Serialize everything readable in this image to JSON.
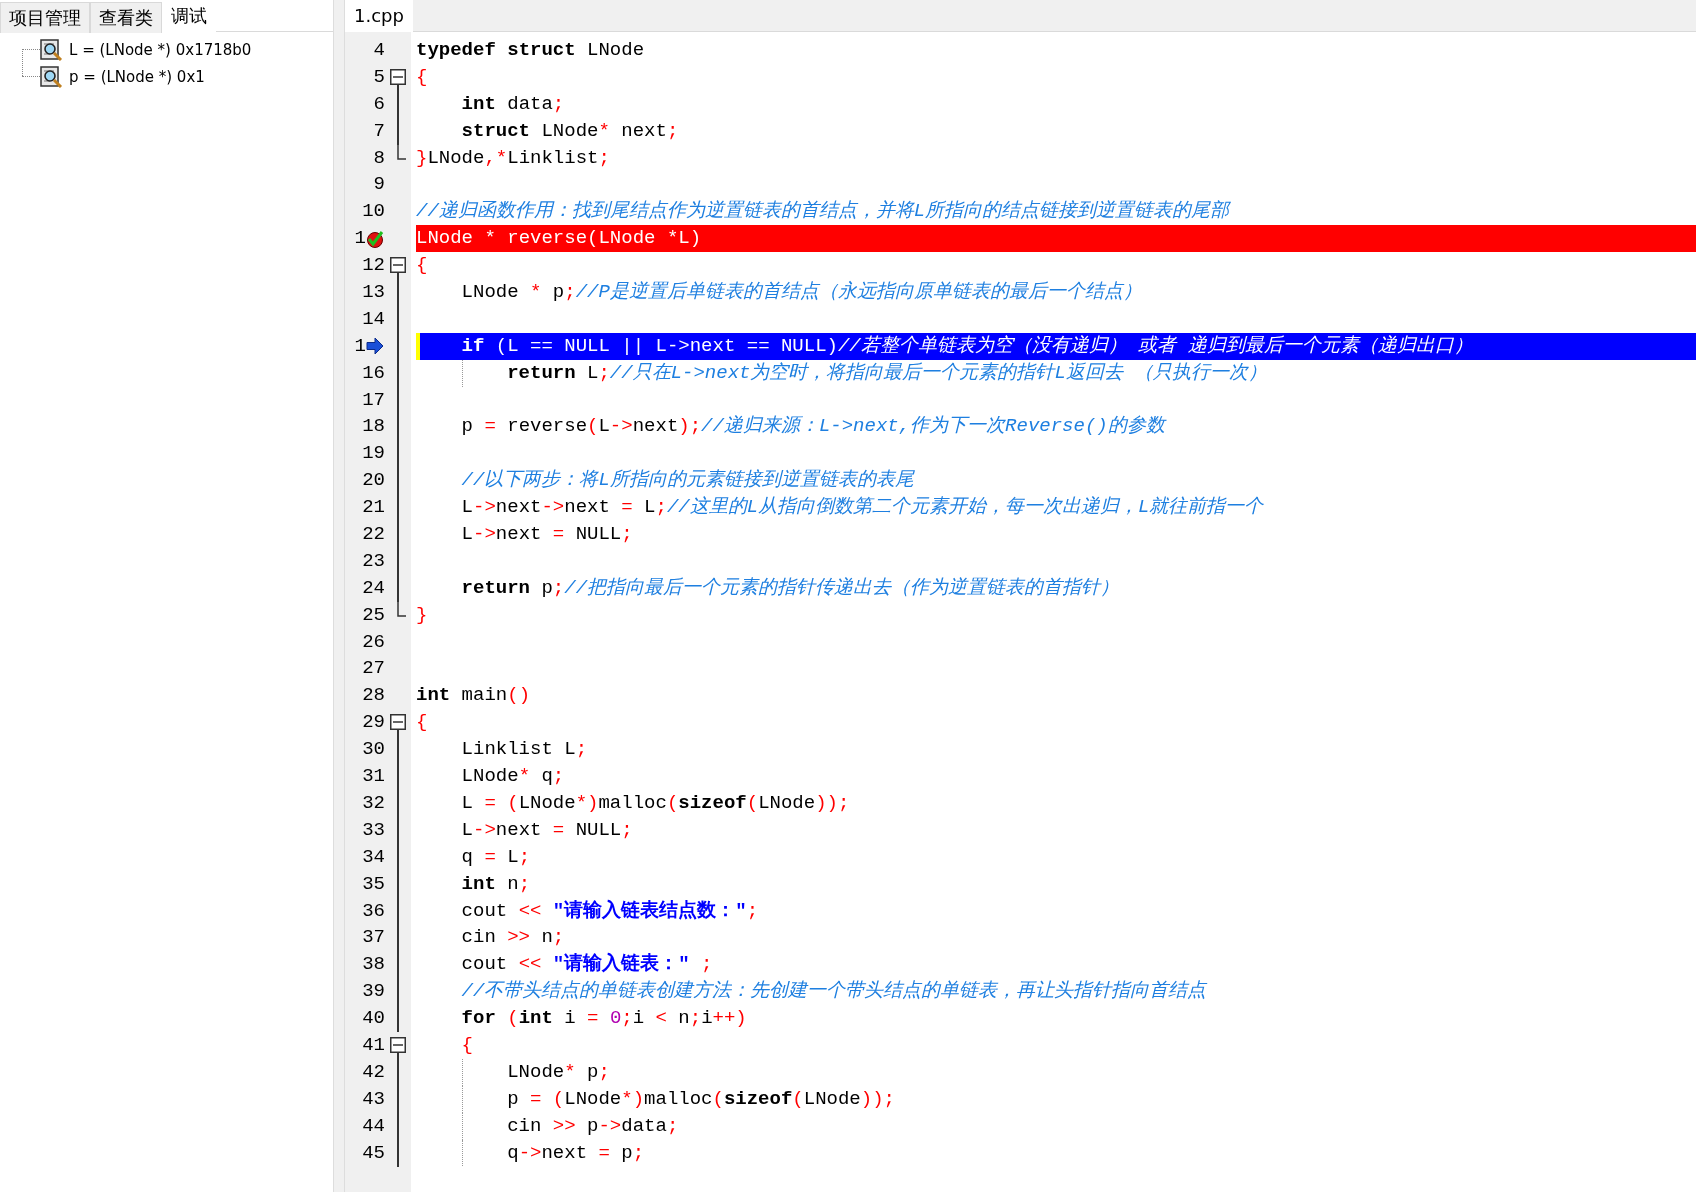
{
  "left_panel": {
    "tabs": [
      {
        "label": "项目管理",
        "selected": false
      },
      {
        "label": "查看类",
        "selected": false
      },
      {
        "label": "调试",
        "selected": true
      }
    ],
    "watches": [
      {
        "text": "L = (LNode *) 0x1718b0"
      },
      {
        "text": "p = (LNode *) 0x1"
      }
    ]
  },
  "editor": {
    "tabs": [
      {
        "label": "1.cpp",
        "selected": true
      }
    ],
    "lines": [
      {
        "number": "4",
        "kind": "normal",
        "tokens": [
          {
            "kind": "kw",
            "text": "typedef"
          },
          {
            "kind": "kw",
            "text": " struct"
          },
          {
            "kind": "id",
            "text": " LNode"
          }
        ]
      },
      {
        "number": "5",
        "kind": "normal",
        "fold_start": true,
        "tokens": [
          {
            "kind": "op",
            "text": "{"
          }
        ]
      },
      {
        "number": "6",
        "kind": "normal",
        "fold_body": true,
        "tokens": [
          {
            "kind": "kw",
            "text": "    int"
          },
          {
            "kind": "id",
            "text": " data"
          },
          {
            "kind": "op",
            "text": ";"
          }
        ]
      },
      {
        "number": "7",
        "kind": "normal",
        "fold_body": true,
        "tokens": [
          {
            "kind": "kw",
            "text": "    struct"
          },
          {
            "kind": "id",
            "text": " LNode"
          },
          {
            "kind": "op",
            "text": "*"
          },
          {
            "kind": "id",
            "text": " next"
          },
          {
            "kind": "op",
            "text": ";"
          }
        ]
      },
      {
        "number": "8",
        "kind": "normal",
        "fold_end": true,
        "tokens": [
          {
            "kind": "op",
            "text": "}"
          },
          {
            "kind": "id",
            "text": "LNode"
          },
          {
            "kind": "op",
            "text": ",*"
          },
          {
            "kind": "id",
            "text": "Linklist"
          },
          {
            "kind": "op",
            "text": ";"
          }
        ]
      },
      {
        "number": "9",
        "kind": "normal"
      },
      {
        "number": "10",
        "kind": "normal",
        "tokens": [
          {
            "kind": "cmt",
            "text": "//递归函数作用：找到尾结点作为逆置链表的首结点，并将L所指向的结点链接到逆置链表的尾部"
          }
        ]
      },
      {
        "number": "1",
        "kind": "breakpoint",
        "tokens": [
          {
            "kind": "id",
            "text": "LNode "
          },
          {
            "kind": "op",
            "text": "*"
          },
          {
            "kind": "id",
            "text": " reverse"
          },
          {
            "kind": "op",
            "text": "("
          },
          {
            "kind": "id",
            "text": "LNode "
          },
          {
            "kind": "op",
            "text": "*"
          },
          {
            "kind": "id",
            "text": "L"
          },
          {
            "kind": "op",
            "text": ")"
          }
        ]
      },
      {
        "number": "12",
        "kind": "normal",
        "fold_start": true,
        "tokens": [
          {
            "kind": "op",
            "text": "{"
          }
        ]
      },
      {
        "number": "13",
        "kind": "normal",
        "fold_body": true,
        "tokens": [
          {
            "kind": "id",
            "text": "    LNode "
          },
          {
            "kind": "op",
            "text": "*"
          },
          {
            "kind": "id",
            "text": " p"
          },
          {
            "kind": "op",
            "text": ";"
          },
          {
            "kind": "cmt",
            "text": "//P是逆置后单链表的首结点（永远指向原单链表的最后一个结点）"
          }
        ]
      },
      {
        "number": "14",
        "kind": "normal",
        "fold_body": true
      },
      {
        "number": "1",
        "kind": "current",
        "fold_body": true,
        "tokens": [
          {
            "kind": "kw",
            "text": "    if"
          },
          {
            "kind": "op",
            "text": " ("
          },
          {
            "kind": "id",
            "text": "L "
          },
          {
            "kind": "op",
            "text": "=="
          },
          {
            "kind": "id",
            "text": " NULL "
          },
          {
            "kind": "op",
            "text": "||"
          },
          {
            "kind": "id",
            "text": " L"
          },
          {
            "kind": "op",
            "text": "->"
          },
          {
            "kind": "id",
            "text": "next "
          },
          {
            "kind": "op",
            "text": "=="
          },
          {
            "kind": "id",
            "text": " NULL"
          },
          {
            "kind": "op",
            "text": ")"
          },
          {
            "kind": "cmt",
            "text": "//若整个单链表为空（没有递归） 或者 递归到最后一个元素（递归出口）"
          }
        ]
      },
      {
        "number": "16",
        "kind": "normal",
        "fold_body": true,
        "guide": true,
        "tokens": [
          {
            "kind": "kw",
            "text": "        return"
          },
          {
            "kind": "id",
            "text": " L"
          },
          {
            "kind": "op",
            "text": ";"
          },
          {
            "kind": "cmt",
            "text": "//只在L->next为空时，将指向最后一个元素的指针L返回去 （只执行一次）"
          }
        ]
      },
      {
        "number": "17",
        "kind": "normal",
        "fold_body": true
      },
      {
        "number": "18",
        "kind": "normal",
        "fold_body": true,
        "tokens": [
          {
            "kind": "id",
            "text": "    p "
          },
          {
            "kind": "op",
            "text": "="
          },
          {
            "kind": "id",
            "text": " reverse"
          },
          {
            "kind": "op",
            "text": "("
          },
          {
            "kind": "id",
            "text": "L"
          },
          {
            "kind": "op",
            "text": "->"
          },
          {
            "kind": "id",
            "text": "next"
          },
          {
            "kind": "op",
            "text": ");"
          },
          {
            "kind": "cmt",
            "text": "//递归来源：L->next,作为下一次Reverse()的参数"
          }
        ]
      },
      {
        "number": "19",
        "kind": "normal",
        "fold_body": true
      },
      {
        "number": "20",
        "kind": "normal",
        "fold_body": true,
        "tokens": [
          {
            "kind": "cmt",
            "text": "    //以下两步：将L所指向的元素链接到逆置链表的表尾"
          }
        ]
      },
      {
        "number": "21",
        "kind": "normal",
        "fold_body": true,
        "tokens": [
          {
            "kind": "id",
            "text": "    L"
          },
          {
            "kind": "op",
            "text": "->"
          },
          {
            "kind": "id",
            "text": "next"
          },
          {
            "kind": "op",
            "text": "->"
          },
          {
            "kind": "id",
            "text": "next "
          },
          {
            "kind": "op",
            "text": "="
          },
          {
            "kind": "id",
            "text": " L"
          },
          {
            "kind": "op",
            "text": ";"
          },
          {
            "kind": "cmt",
            "text": "//这里的L从指向倒数第二个元素开始，每一次出递归，L就往前指一个"
          }
        ]
      },
      {
        "number": "22",
        "kind": "normal",
        "fold_body": true,
        "tokens": [
          {
            "kind": "id",
            "text": "    L"
          },
          {
            "kind": "op",
            "text": "->"
          },
          {
            "kind": "id",
            "text": "next "
          },
          {
            "kind": "op",
            "text": "="
          },
          {
            "kind": "id",
            "text": " NULL"
          },
          {
            "kind": "op",
            "text": ";"
          }
        ]
      },
      {
        "number": "23",
        "kind": "normal",
        "fold_body": true
      },
      {
        "number": "24",
        "kind": "normal",
        "fold_body": true,
        "tokens": [
          {
            "kind": "kw",
            "text": "    return"
          },
          {
            "kind": "id",
            "text": " p"
          },
          {
            "kind": "op",
            "text": ";"
          },
          {
            "kind": "cmt",
            "text": "//把指向最后一个元素的指针传递出去（作为逆置链表的首指针）"
          }
        ]
      },
      {
        "number": "25",
        "kind": "normal",
        "fold_end": true,
        "tokens": [
          {
            "kind": "op",
            "text": "}"
          }
        ]
      },
      {
        "number": "26",
        "kind": "normal"
      },
      {
        "number": "27",
        "kind": "normal"
      },
      {
        "number": "28",
        "kind": "normal",
        "tokens": [
          {
            "kind": "kw",
            "text": "int"
          },
          {
            "kind": "id",
            "text": " main"
          },
          {
            "kind": "op",
            "text": "()"
          }
        ]
      },
      {
        "number": "29",
        "kind": "normal",
        "fold_start": true,
        "tokens": [
          {
            "kind": "op",
            "text": "{"
          }
        ]
      },
      {
        "number": "30",
        "kind": "normal",
        "fold_body": true,
        "tokens": [
          {
            "kind": "id",
            "text": "    Linklist L"
          },
          {
            "kind": "op",
            "text": ";"
          }
        ]
      },
      {
        "number": "31",
        "kind": "normal",
        "fold_body": true,
        "tokens": [
          {
            "kind": "id",
            "text": "    LNode"
          },
          {
            "kind": "op",
            "text": "*"
          },
          {
            "kind": "id",
            "text": " q"
          },
          {
            "kind": "op",
            "text": ";"
          }
        ]
      },
      {
        "number": "32",
        "kind": "normal",
        "fold_body": true,
        "tokens": [
          {
            "kind": "id",
            "text": "    L "
          },
          {
            "kind": "op",
            "text": "= ("
          },
          {
            "kind": "id",
            "text": "LNode"
          },
          {
            "kind": "op",
            "text": "*)"
          },
          {
            "kind": "id",
            "text": "malloc"
          },
          {
            "kind": "op",
            "text": "("
          },
          {
            "kind": "kw",
            "text": "sizeof"
          },
          {
            "kind": "op",
            "text": "("
          },
          {
            "kind": "id",
            "text": "LNode"
          },
          {
            "kind": "op",
            "text": "));"
          }
        ]
      },
      {
        "number": "33",
        "kind": "normal",
        "fold_body": true,
        "tokens": [
          {
            "kind": "id",
            "text": "    L"
          },
          {
            "kind": "op",
            "text": "->"
          },
          {
            "kind": "id",
            "text": "next "
          },
          {
            "kind": "op",
            "text": "="
          },
          {
            "kind": "id",
            "text": " NULL"
          },
          {
            "kind": "op",
            "text": ";"
          }
        ]
      },
      {
        "number": "34",
        "kind": "normal",
        "fold_body": true,
        "tokens": [
          {
            "kind": "id",
            "text": "    q "
          },
          {
            "kind": "op",
            "text": "="
          },
          {
            "kind": "id",
            "text": " L"
          },
          {
            "kind": "op",
            "text": ";"
          }
        ]
      },
      {
        "number": "35",
        "kind": "normal",
        "fold_body": true,
        "tokens": [
          {
            "kind": "kw",
            "text": "    int"
          },
          {
            "kind": "id",
            "text": " n"
          },
          {
            "kind": "op",
            "text": ";"
          }
        ]
      },
      {
        "number": "36",
        "kind": "normal",
        "fold_body": true,
        "tokens": [
          {
            "kind": "id",
            "text": "    cout "
          },
          {
            "kind": "op",
            "text": "<<"
          },
          {
            "kind": "str",
            "text": " \"请输入链表结点数：\""
          },
          {
            "kind": "op",
            "text": ";"
          }
        ]
      },
      {
        "number": "37",
        "kind": "normal",
        "fold_body": true,
        "tokens": [
          {
            "kind": "id",
            "text": "    cin "
          },
          {
            "kind": "op",
            "text": ">>"
          },
          {
            "kind": "id",
            "text": " n"
          },
          {
            "kind": "op",
            "text": ";"
          }
        ]
      },
      {
        "number": "38",
        "kind": "normal",
        "fold_body": true,
        "tokens": [
          {
            "kind": "id",
            "text": "    cout "
          },
          {
            "kind": "op",
            "text": "<<"
          },
          {
            "kind": "str",
            "text": " \"请输入链表：\""
          },
          {
            "kind": "op",
            "text": " ;"
          }
        ]
      },
      {
        "number": "39",
        "kind": "normal",
        "fold_body": true,
        "tokens": [
          {
            "kind": "cmt",
            "text": "    //不带头结点的单链表创建方法：先创建一个带头结点的单链表，再让头指针指向首结点"
          }
        ]
      },
      {
        "number": "40",
        "kind": "normal",
        "fold_body": true,
        "tokens": [
          {
            "kind": "kw",
            "text": "    for"
          },
          {
            "kind": "op",
            "text": " ("
          },
          {
            "kind": "kw",
            "text": "int"
          },
          {
            "kind": "id",
            "text": " i "
          },
          {
            "kind": "op",
            "text": "="
          },
          {
            "kind": "num",
            "text": " 0"
          },
          {
            "kind": "op",
            "text": ";"
          },
          {
            "kind": "id",
            "text": "i "
          },
          {
            "kind": "op",
            "text": "<"
          },
          {
            "kind": "id",
            "text": " n"
          },
          {
            "kind": "op",
            "text": ";"
          },
          {
            "kind": "id",
            "text": "i"
          },
          {
            "kind": "op",
            "text": "++)"
          }
        ]
      },
      {
        "number": "41",
        "kind": "normal",
        "fold_start": true,
        "tokens": [
          {
            "kind": "op",
            "text": "    {"
          }
        ]
      },
      {
        "number": "42",
        "kind": "normal",
        "fold_body": true,
        "guide": true,
        "tokens": [
          {
            "kind": "id",
            "text": "        LNode"
          },
          {
            "kind": "op",
            "text": "*"
          },
          {
            "kind": "id",
            "text": " p"
          },
          {
            "kind": "op",
            "text": ";"
          }
        ]
      },
      {
        "number": "43",
        "kind": "normal",
        "fold_body": true,
        "guide": true,
        "tokens": [
          {
            "kind": "id",
            "text": "        p "
          },
          {
            "kind": "op",
            "text": "= ("
          },
          {
            "kind": "id",
            "text": "LNode"
          },
          {
            "kind": "op",
            "text": "*)"
          },
          {
            "kind": "id",
            "text": "malloc"
          },
          {
            "kind": "op",
            "text": "("
          },
          {
            "kind": "kw",
            "text": "sizeof"
          },
          {
            "kind": "op",
            "text": "("
          },
          {
            "kind": "id",
            "text": "LNode"
          },
          {
            "kind": "op",
            "text": "));"
          }
        ]
      },
      {
        "number": "44",
        "kind": "normal",
        "fold_body": true,
        "guide": true,
        "tokens": [
          {
            "kind": "id",
            "text": "        cin "
          },
          {
            "kind": "op",
            "text": ">>"
          },
          {
            "kind": "id",
            "text": " p"
          },
          {
            "kind": "op",
            "text": "->"
          },
          {
            "kind": "id",
            "text": "data"
          },
          {
            "kind": "op",
            "text": ";"
          }
        ]
      },
      {
        "number": "45",
        "kind": "normal",
        "fold_body": true,
        "guide": true,
        "tokens": [
          {
            "kind": "id",
            "text": "        q"
          },
          {
            "kind": "op",
            "text": "->"
          },
          {
            "kind": "id",
            "text": "next "
          },
          {
            "kind": "op",
            "text": "="
          },
          {
            "kind": "id",
            "text": " p"
          },
          {
            "kind": "op",
            "text": ";"
          }
        ]
      }
    ]
  }
}
